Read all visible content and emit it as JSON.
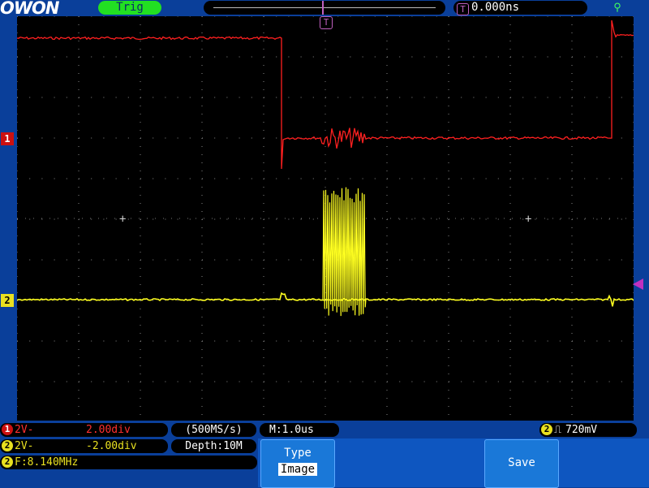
{
  "brand": {
    "logo": "OWON"
  },
  "topbar": {
    "trigger_status": "Trig",
    "trigger_time_icon": "T",
    "horizontal_position": "0.000ns",
    "usb_icon": "usb-icon"
  },
  "markers": {
    "ch1": "1",
    "ch2": "2",
    "trigger_top": "T"
  },
  "channels": [
    {
      "num": "1",
      "coupling": "2V-",
      "scale": "2.00div",
      "color": "#ff2020"
    },
    {
      "num": "2",
      "coupling": "2V-",
      "scale": "-2.00div",
      "color": "#ffff20"
    }
  ],
  "acquisition": {
    "sample_rate": "(500MS/s)",
    "depth": "Depth:10M"
  },
  "timebase": {
    "main": "M:1.0us"
  },
  "trigger": {
    "source": "2",
    "level": "720mV",
    "edge_icon": "rising-edge-icon"
  },
  "measurement": {
    "source": "2",
    "frequency": "F:8.140MHz"
  },
  "menu": {
    "type_label": "Type",
    "type_value": "Image",
    "save_label": "Save"
  },
  "colors": {
    "background": "#0a3f9a",
    "screen": "#000000",
    "trig_badge": "#22e022",
    "trigger_marker": "#c030c0"
  }
}
